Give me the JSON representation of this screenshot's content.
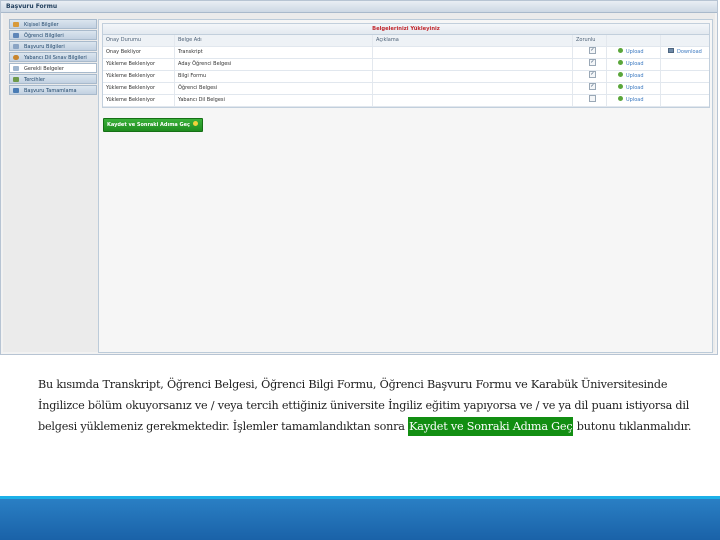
{
  "window": {
    "title": "Başvuru Formu"
  },
  "sidebar": {
    "items": [
      {
        "label": "Kişisel Bilgiler",
        "icon": "user-icon"
      },
      {
        "label": "Öğrenci Bilgileri",
        "icon": "student-icon"
      },
      {
        "label": "Başvuru Bilgileri",
        "icon": "form-icon"
      },
      {
        "label": "Yabancı Dil Sınav Bilgileri",
        "icon": "language-icon"
      },
      {
        "label": "Gerekli Belgeler",
        "icon": "documents-icon",
        "active": true
      },
      {
        "label": "Tercihler",
        "icon": "preferences-icon"
      },
      {
        "label": "Başvuru Tamamlama",
        "icon": "complete-icon"
      }
    ]
  },
  "documents": {
    "title": "Belgelerinizi Yükleyiniz",
    "columns": [
      "Onay Durumu",
      "Belge Adı",
      "Açıklama",
      "Zorunlu",
      "",
      ""
    ],
    "rows": [
      {
        "status": "Onay Bekliyor",
        "name": "Transkript",
        "note": "",
        "required": true,
        "upload": "Upload",
        "download": "Download"
      },
      {
        "status": "Yükleme Bekleniyor",
        "name": "Aday Öğrenci Belgesi",
        "note": "",
        "required": true,
        "upload": "Upload"
      },
      {
        "status": "Yükleme Bekleniyor",
        "name": "Bilgi Formu",
        "note": "",
        "required": true,
        "upload": "Upload"
      },
      {
        "status": "Yükleme Bekleniyor",
        "name": "Öğrenci Belgesi",
        "note": "",
        "required": true,
        "upload": "Upload"
      },
      {
        "status": "Yükleme Bekleniyor",
        "name": "Yabancı Dil Belgesi",
        "note": "",
        "required": false,
        "upload": "Upload"
      }
    ]
  },
  "save_button": {
    "label": "Kaydet ve Sonraki Adıma Geç"
  },
  "caption": {
    "before": "Bu kısımda Transkript, Öğrenci Belgesi, Öğrenci Bilgi Formu, Öğrenci Başvuru Formu ve Karabük Üniversitesinde İngilizce bölüm okuyorsanız ve / veya tercih ettiğiniz üniversite İngiliz eğitim yapıyorsa ve / ve ya dil puanı istiyorsa dil belgesi yüklemeniz gerekmektedir. İşlemler tamamlandıktan sonra ",
    "highlight": "Kaydet ve Sonraki Adıma Geç",
    "after": " butonu tıklanmalıdır."
  },
  "colors": {
    "highlight": "#128e12",
    "band": "#1f6fb5",
    "band_accent": "#1cb0e8",
    "title_red": "#c1272d"
  }
}
